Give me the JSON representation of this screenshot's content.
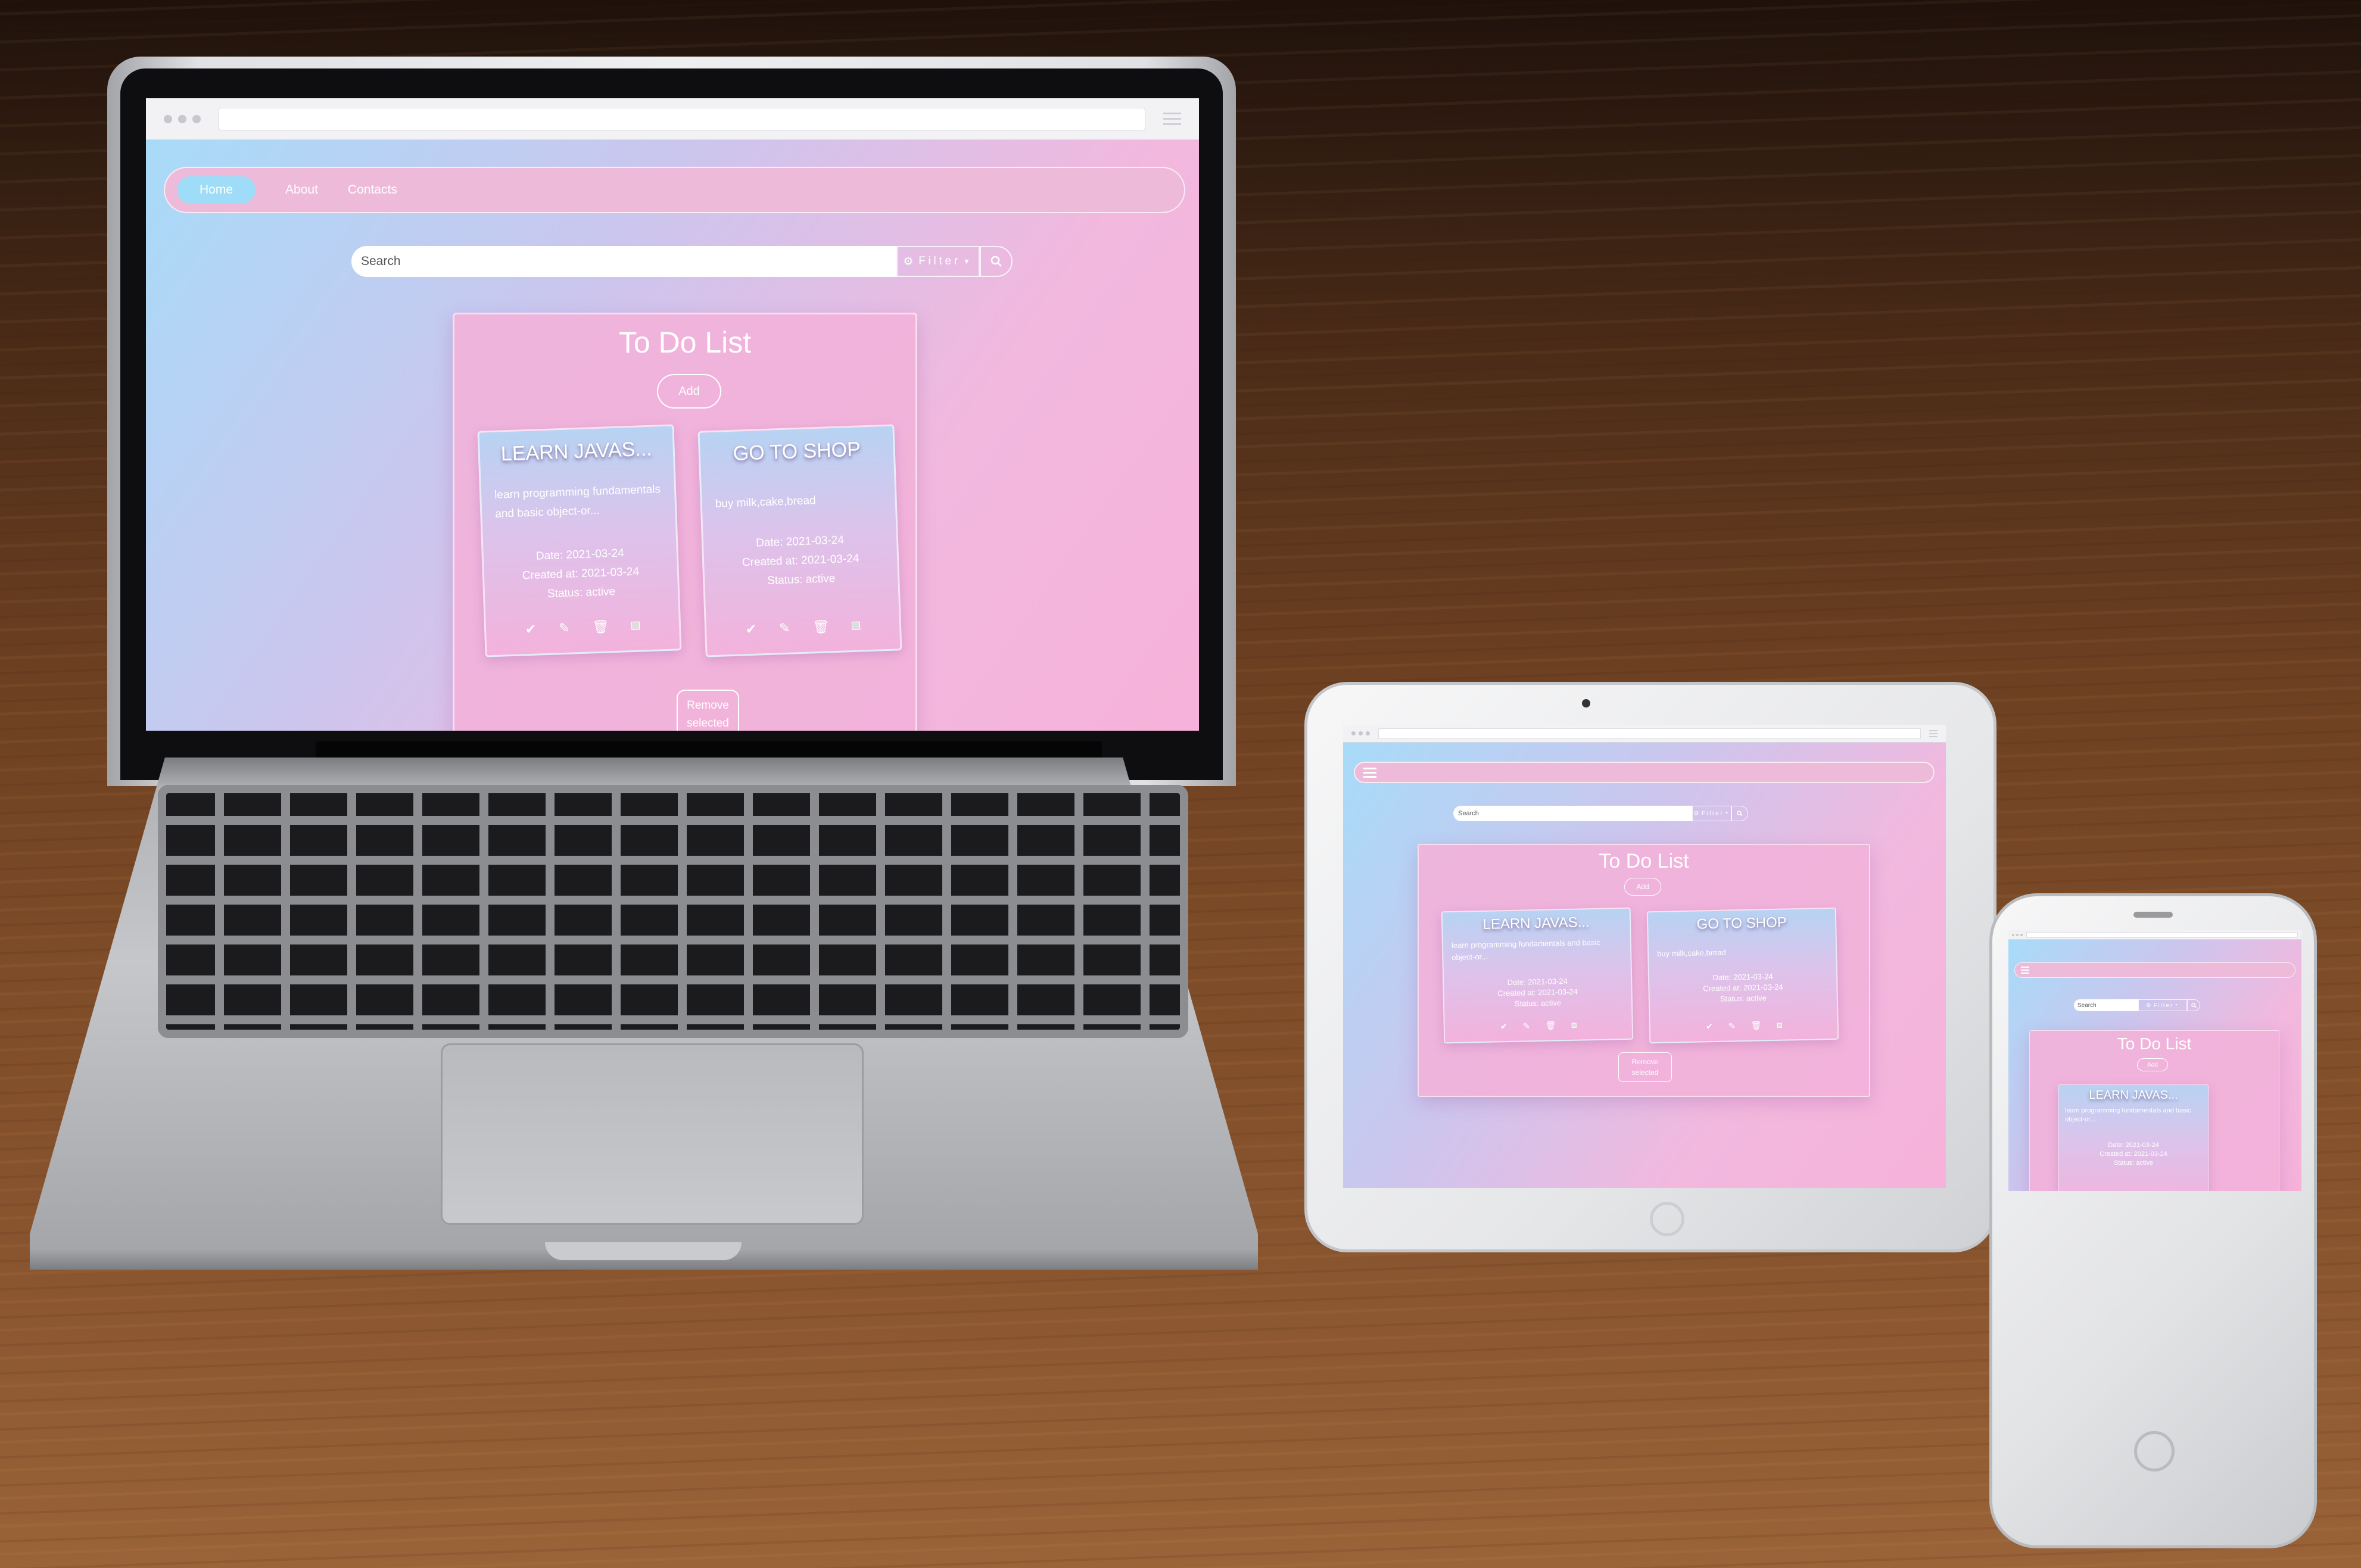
{
  "app": {
    "nav": {
      "home": "Home",
      "about": "About",
      "contacts": "Contacts"
    },
    "search": {
      "placeholder": "Search",
      "filter_label": "Filter"
    },
    "todo": {
      "title": "To Do List",
      "add_label": "Add",
      "remove_label_line1": "Remove",
      "remove_label_line2": "selected",
      "tasks": [
        {
          "title": "LEARN JAVAS...",
          "description": "learn programming fundamentals and basic object-or...",
          "description_tablet": "learn programming fundamentals and basic object-or...",
          "date": "Date: 2021-03-24",
          "created": "Created at: 2021-03-24",
          "status": "Status: active"
        },
        {
          "title": "GO TO SHOP",
          "description": "buy milk,cake,bread",
          "date": "Date: 2021-03-24",
          "created": "Created at: 2021-03-24",
          "status": "Status: active"
        }
      ]
    }
  },
  "icons": [
    "check-icon",
    "edit-icon",
    "trash-icon",
    "select-checkbox",
    "gear-icon",
    "caret-down-icon",
    "search-icon",
    "menu-icon"
  ],
  "colors": {
    "gradient_start": "#a6dcf9",
    "gradient_end": "#f6b2da",
    "nav_active": "#9fdcf7",
    "panel": "#f2b2da"
  }
}
